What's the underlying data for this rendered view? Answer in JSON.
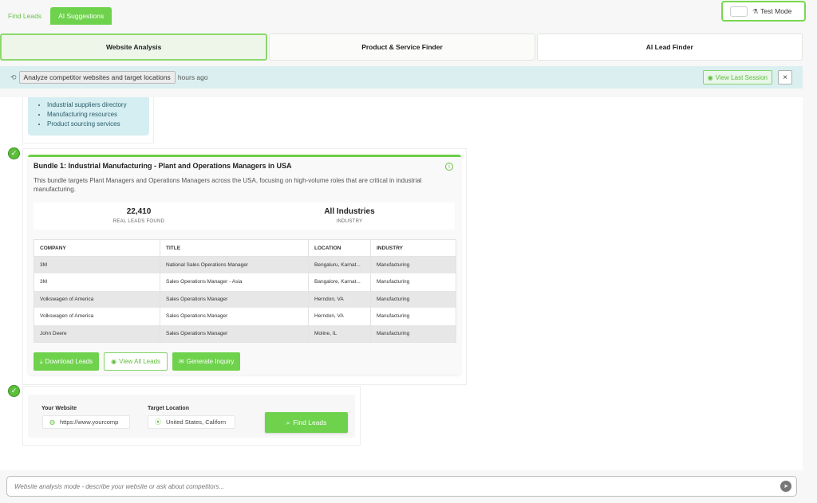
{
  "top_tabs": [
    {
      "label": "Find Leads",
      "active": false
    },
    {
      "label": "AI Suggestions",
      "active": true
    }
  ],
  "test_mode": {
    "label": "Test Mode"
  },
  "mode_tabs": [
    {
      "label": "Website Analysis",
      "active": true
    },
    {
      "label": "Product & Service Finder",
      "active": false
    },
    {
      "label": "AI Lead Finder",
      "active": false
    }
  ],
  "banner": {
    "tooltip": "Analyze competitor websites and target locations",
    "text": "hours ago",
    "view_last_label": "View Last Session",
    "close_label": "×"
  },
  "suggestions": [
    "Industrial suppliers directory",
    "Manufacturing resources",
    "Product sourcing services"
  ],
  "bundle": {
    "title": "Bundle 1: Industrial Manufacturing - Plant and Operations Managers in USA",
    "description": "This bundle targets Plant Managers and Operations Managers across the USA, focusing on high-volume roles that are critical in industrial manufacturing.",
    "stats": [
      {
        "value": "22,410",
        "label": "REAL LEADS FOUND"
      },
      {
        "value": "All Industries",
        "label": "INDUSTRY"
      }
    ],
    "table": {
      "headers": [
        "COMPANY",
        "TITLE",
        "LOCATION",
        "INDUSTRY"
      ],
      "rows": [
        [
          "3M",
          "National Sales Operations Manager",
          "Bengaluru, Karnat...",
          "Manufacturing"
        ],
        [
          "3M",
          "Sales Operations Manager - Asia",
          "Bangalore, Karnat...",
          "Manufacturing"
        ],
        [
          "Volkswagen of America",
          "Sales Operations Manager",
          "Herndon, VA",
          "Manufacturing"
        ],
        [
          "Volkswagen of America",
          "Sales Operations Manager",
          "Herndon, VA",
          "Manufacturing"
        ],
        [
          "John Deere",
          "Sales Operations Manager",
          "Moline, IL",
          "Manufacturing"
        ]
      ]
    },
    "actions": {
      "download": "Download Leads",
      "view_all": "View All Leads",
      "generate": "Generate Inquiry"
    }
  },
  "form": {
    "website_label": "Your Website",
    "website_value": "https://www.yourcomp",
    "location_label": "Target Location",
    "location_value": "United States, Californ",
    "find_label": "Find Leads"
  },
  "chat": {
    "placeholder": "Website analysis mode - describe your website or ask about competitors..."
  },
  "colors": {
    "accent": "#6fd24d",
    "banner": "#dbeff1"
  }
}
